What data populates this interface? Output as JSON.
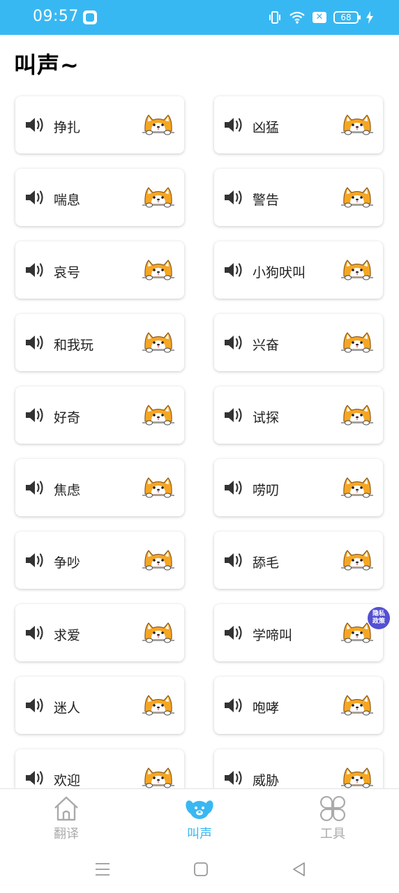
{
  "status_bar": {
    "time": "09:57",
    "battery": "68"
  },
  "page": {
    "title": "叫声~"
  },
  "sounds": [
    "挣扎",
    "凶猛",
    "喘息",
    "警告",
    "哀号",
    "小狗吠叫",
    "和我玩",
    "兴奋",
    "好奇",
    "试探",
    "焦虑",
    "唠叨",
    "争吵",
    "舔毛",
    "求爱",
    "学啼叫",
    "迷人",
    "咆哮",
    "欢迎",
    "威胁"
  ],
  "badge": {
    "line1": "隐私",
    "line2": "政策"
  },
  "nav": {
    "translate": "翻译",
    "bark": "叫声",
    "tools": "工具",
    "active": "bark"
  },
  "colors": {
    "accent": "#38b8f2",
    "badge": "#5450d3",
    "dog": "#f5a623"
  },
  "icons": {
    "card_left": "speaker-icon",
    "card_right": "puppy-icon",
    "nav_translate": "house-icon",
    "nav_bark": "dog-icon",
    "nav_tools": "clover-icon"
  }
}
